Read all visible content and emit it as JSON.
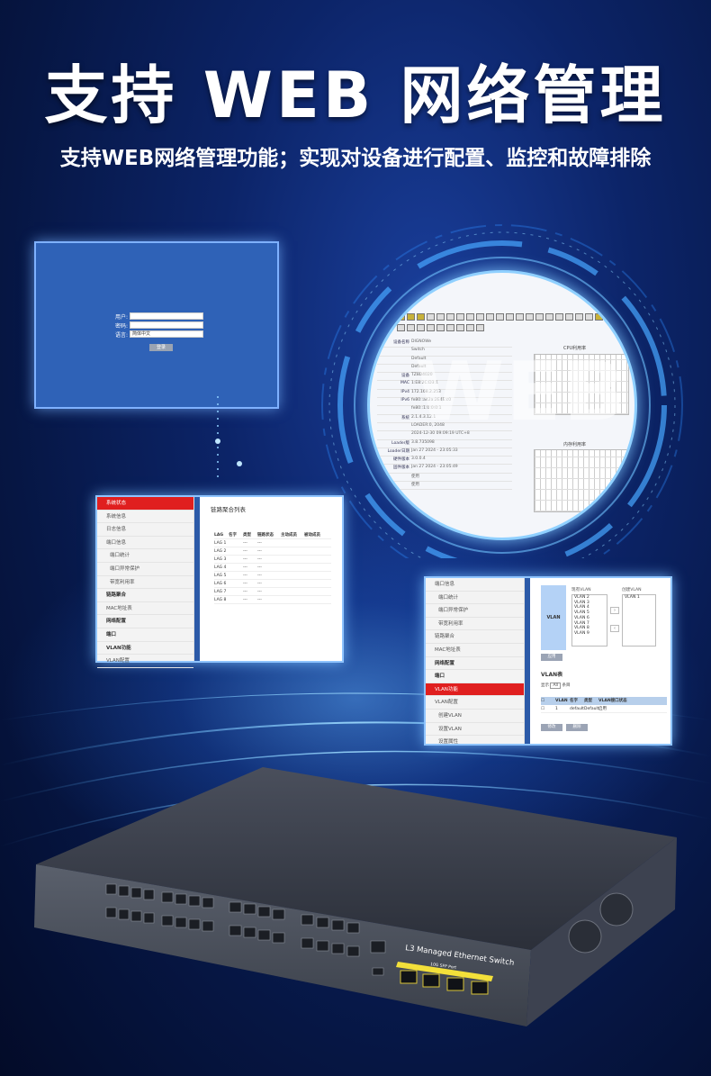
{
  "headline": "支持 WEB 网络管理",
  "subline": "支持WEB网络管理功能；实现对设备进行配置、监控和故障排除",
  "login": {
    "user_label": "用户:",
    "pass_label": "密码:",
    "lang_label": "语言:",
    "lang_value": "简体中文",
    "login_button": "登录"
  },
  "dashboard": {
    "watermark": "WEB",
    "cpu_title": "CPU利用率",
    "mem_title": "内存利用率",
    "info": [
      {
        "k": "设备名称",
        "v": "DIGNOWe"
      },
      {
        "k": "",
        "v": "Switch"
      },
      {
        "k": "",
        "v": "Default"
      },
      {
        "k": "",
        "v": "Default"
      },
      {
        "k": "设备",
        "v": "TZ8D4020"
      },
      {
        "k": "MAC",
        "v": "1:E8:2C:D3:1"
      },
      {
        "k": "IPv4",
        "v": "172.168.2.253"
      },
      {
        "k": "IPv6",
        "v": "fe80::a42a:2E4E:c0"
      },
      {
        "k": "",
        "v": "fe80::1:0:0:0:1"
      },
      {
        "k": "系统",
        "v": "2.1.4.3.12.1"
      },
      {
        "k": "",
        "v": "LOADER:0, 2048"
      },
      {
        "k": "",
        "v": "2024-12-30 09:09:19 UTC+8"
      },
      {
        "k": "Loader版",
        "v": "3.8.735098"
      },
      {
        "k": "Loader日期",
        "v": "Jan 27 2024 - 23:05:33"
      },
      {
        "k": "硬件版本",
        "v": "3.0.0.4"
      },
      {
        "k": "固件版本",
        "v": "Jan 27 2024 - 23:05:49"
      },
      {
        "k": "",
        "v": "使用"
      },
      {
        "k": "",
        "v": "使用"
      }
    ]
  },
  "lag_panel": {
    "title": "链路聚合列表",
    "menu": [
      "系统状态",
      "系统信息",
      "日志信息",
      "端口信息",
      "端口统计",
      "端口异常保护",
      "带宽利用率",
      "链路聚合",
      "MAC地址表",
      "网络配置",
      "端口",
      "VLAN功能",
      "VLAN配置"
    ],
    "columns": [
      "LAG",
      "名字",
      "类型",
      "链路状态",
      "主动成员",
      "被动成员"
    ],
    "rows": [
      "LAG 1",
      "LAG 2",
      "LAG 3",
      "LAG 4",
      "LAG 5",
      "LAG 6",
      "LAG 7",
      "LAG 8"
    ],
    "dash": "---"
  },
  "vlan_panel": {
    "menu": [
      "端口信息",
      "端口统计",
      "端口异常保护",
      "带宽利用率",
      "链路聚合",
      "MAC地址表",
      "网络配置",
      "端口",
      "VLAN功能",
      "VLAN配置",
      "创建VLAN",
      "设置VLAN",
      "设置属性"
    ],
    "vlan_label": "VLAN",
    "existing_head": "现有VLAN",
    "create_head": "创建VLAN",
    "existing": [
      "VLAN 2",
      "VLAN 3",
      "VLAN 4",
      "VLAN 5",
      "VLAN 6",
      "VLAN 7",
      "VLAN 8",
      "VLAN 9"
    ],
    "created": [
      "VLAN 1"
    ],
    "apply": "应用",
    "table_title": "VLAN表",
    "show_label": "显示",
    "show_value": "All",
    "show_unit": "条目",
    "columns": [
      "VLAN",
      "名字",
      "类型",
      "VLAN接口状态"
    ],
    "row": [
      "1",
      "default",
      "Default",
      "启用"
    ],
    "edit": "修改",
    "delete": "删除"
  },
  "switch": {
    "label": "L3 Managed Ethernet Switch",
    "sfp_label": "10G SFP Port"
  }
}
